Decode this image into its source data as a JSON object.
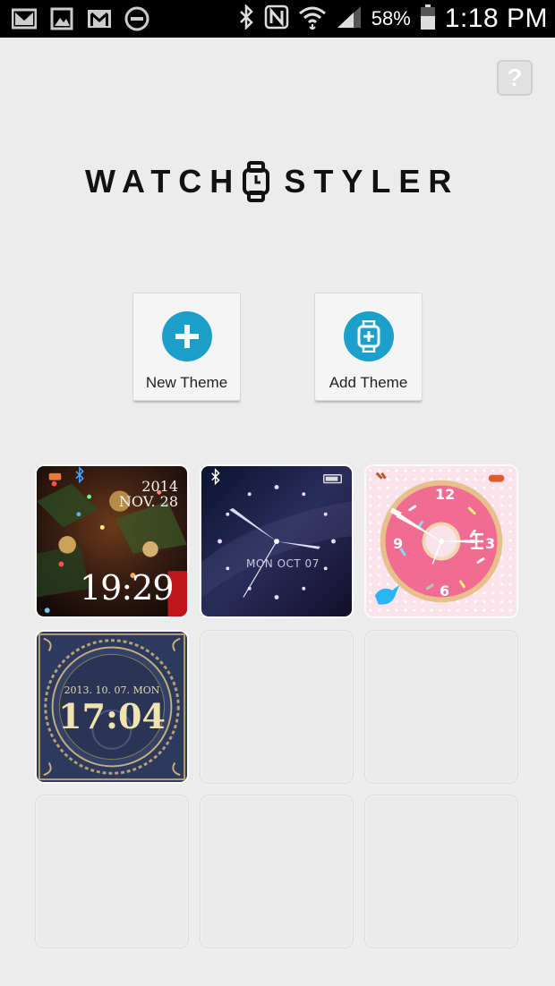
{
  "status_bar": {
    "notification_icons": [
      "gmail-icon",
      "gallery-icon",
      "gmail-icon",
      "do-not-disturb-icon"
    ],
    "system_icons": [
      "bluetooth-icon",
      "nfc-icon",
      "wifi-icon",
      "signal-icon",
      "battery-icon"
    ],
    "battery": "58%",
    "time": "1:18 PM"
  },
  "help": {
    "label": "?"
  },
  "logo": {
    "left": "WATCH",
    "right": "STYLER"
  },
  "actions": {
    "new_theme": "New Theme",
    "add_theme": "Add Theme"
  },
  "themes": [
    {
      "name": "christmas",
      "date_line1": "2014",
      "date_line2": "NOV. 28",
      "time": "19:29"
    },
    {
      "name": "galaxy",
      "date": "MON OCT 07"
    },
    {
      "name": "donut",
      "numbers": [
        "12",
        "3",
        "6",
        "9"
      ]
    },
    {
      "name": "royal",
      "date": "2013. 10. 07. MON",
      "time": "17:04"
    }
  ],
  "colors": {
    "accent": "#1ba0cc",
    "background": "#ececec",
    "status_bar": "#000000"
  }
}
